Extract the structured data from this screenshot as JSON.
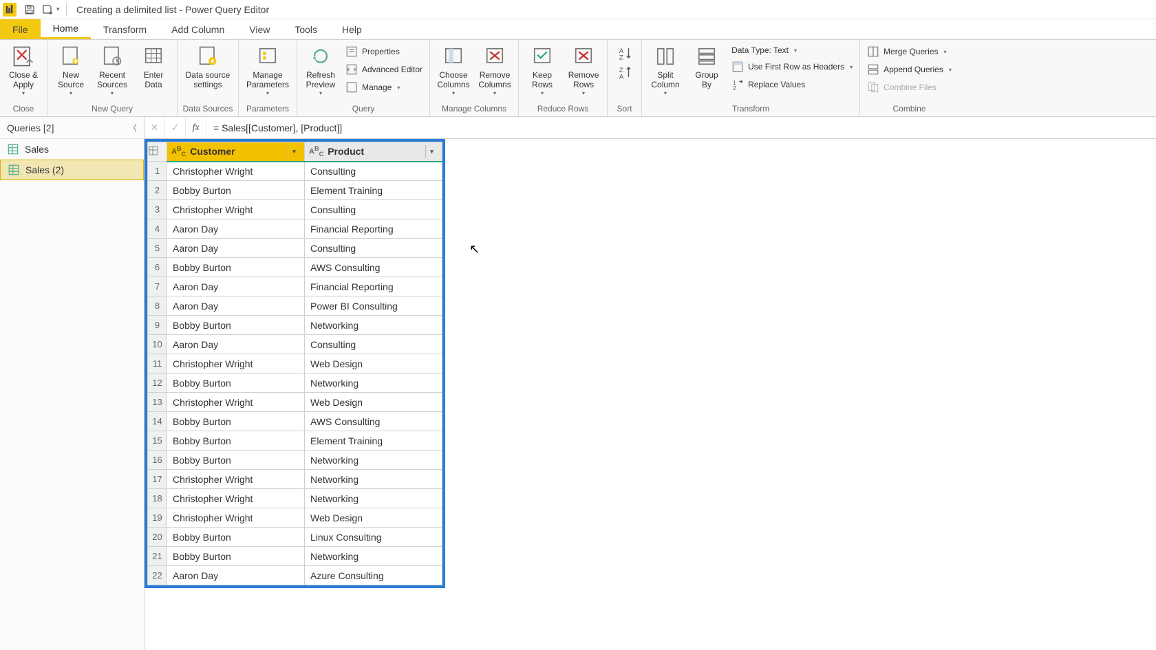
{
  "titlebar": {
    "title": "Creating a delimited list - Power Query Editor"
  },
  "menu": {
    "file": "File",
    "tabs": [
      "Home",
      "Transform",
      "Add Column",
      "View",
      "Tools",
      "Help"
    ],
    "active": "Home"
  },
  "ribbon": {
    "close": {
      "close_apply": "Close &\nApply",
      "group": "Close"
    },
    "newquery": {
      "new_source": "New\nSource",
      "recent_sources": "Recent\nSources",
      "enter_data": "Enter\nData",
      "group": "New Query"
    },
    "datasources": {
      "settings": "Data source\nsettings",
      "group": "Data Sources"
    },
    "params": {
      "manage": "Manage\nParameters",
      "group": "Parameters"
    },
    "query": {
      "refresh": "Refresh\nPreview",
      "properties": "Properties",
      "advanced": "Advanced Editor",
      "manage": "Manage",
      "group": "Query"
    },
    "managecols": {
      "choose": "Choose\nColumns",
      "remove": "Remove\nColumns",
      "group": "Manage Columns"
    },
    "reducerows": {
      "keep": "Keep\nRows",
      "remove": "Remove\nRows",
      "group": "Reduce Rows"
    },
    "sort": {
      "group": "Sort"
    },
    "transform": {
      "split": "Split\nColumn",
      "groupby": "Group\nBy",
      "datatype": "Data Type: Text",
      "firstrow": "Use First Row as Headers",
      "replace": "Replace Values",
      "group": "Transform"
    },
    "combine": {
      "merge": "Merge Queries",
      "append": "Append Queries",
      "combine_files": "Combine Files",
      "group": "Combine"
    }
  },
  "queries_panel": {
    "header": "Queries [2]",
    "items": [
      {
        "name": "Sales",
        "selected": false
      },
      {
        "name": "Sales (2)",
        "selected": true
      }
    ]
  },
  "formula": "= Sales[[Customer], [Product]]",
  "grid": {
    "columns": [
      {
        "name": "Customer",
        "type": "ABC",
        "selected": true
      },
      {
        "name": "Product",
        "type": "ABC",
        "selected": false
      }
    ],
    "rows": [
      [
        "Christopher Wright",
        "Consulting"
      ],
      [
        "Bobby Burton",
        "Element Training"
      ],
      [
        "Christopher Wright",
        "Consulting"
      ],
      [
        "Aaron Day",
        "Financial Reporting"
      ],
      [
        "Aaron Day",
        "Consulting"
      ],
      [
        "Bobby Burton",
        "AWS Consulting"
      ],
      [
        "Aaron Day",
        "Financial Reporting"
      ],
      [
        "Aaron Day",
        "Power BI Consulting"
      ],
      [
        "Bobby Burton",
        "Networking"
      ],
      [
        "Aaron Day",
        "Consulting"
      ],
      [
        "Christopher Wright",
        "Web Design"
      ],
      [
        "Bobby Burton",
        "Networking"
      ],
      [
        "Christopher Wright",
        "Web Design"
      ],
      [
        "Bobby Burton",
        "AWS Consulting"
      ],
      [
        "Bobby Burton",
        "Element Training"
      ],
      [
        "Bobby Burton",
        "Networking"
      ],
      [
        "Christopher Wright",
        "Networking"
      ],
      [
        "Christopher Wright",
        "Networking"
      ],
      [
        "Christopher Wright",
        "Web Design"
      ],
      [
        "Bobby Burton",
        "Linux Consulting"
      ],
      [
        "Bobby Burton",
        "Networking"
      ],
      [
        "Aaron Day",
        "Azure Consulting"
      ]
    ]
  }
}
